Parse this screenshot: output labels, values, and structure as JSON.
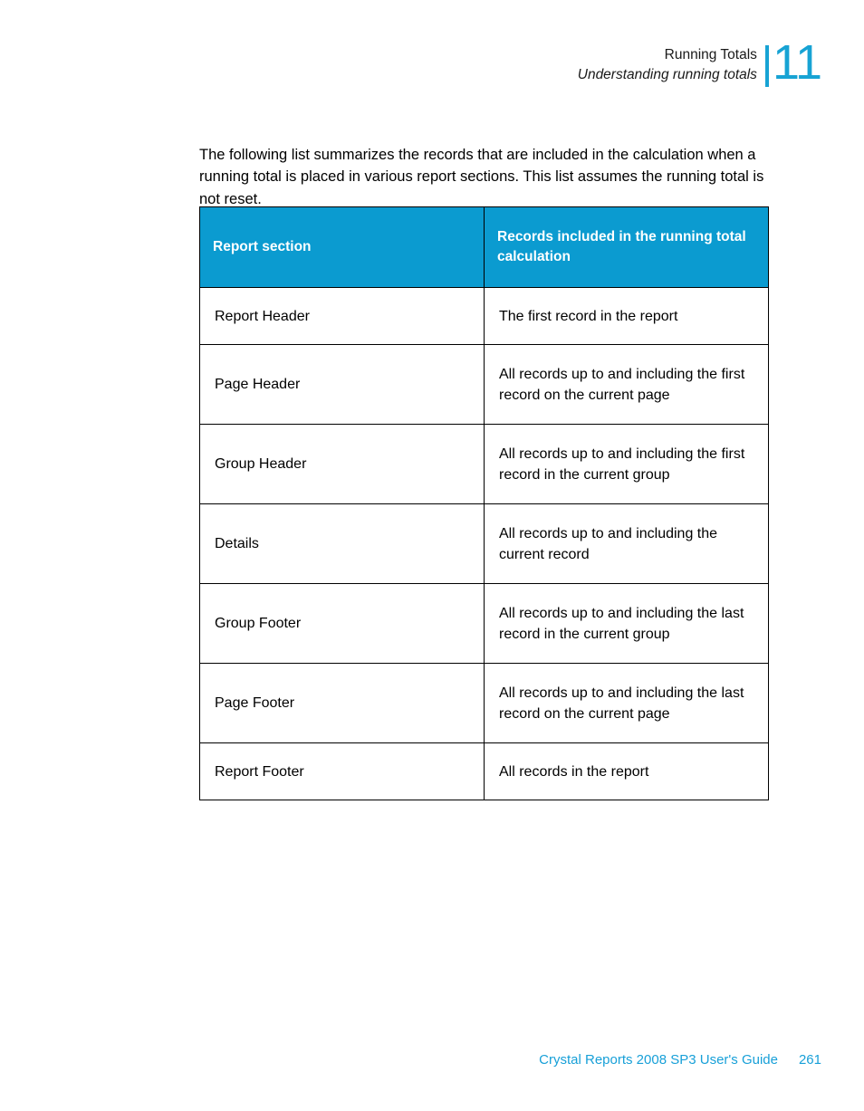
{
  "running_head": {
    "title": "Running Totals",
    "subtitle": "Understanding running totals",
    "chapter_number": "11",
    "accent_color": "#17a3d4"
  },
  "intro_paragraph": "The following list summarizes the records that are included in the calculation when a running total is placed in various report sections. This list assumes the running total is not reset.",
  "table": {
    "header_background": "#0b9bd0",
    "header_text_color": "#ffffff",
    "columns": [
      "Report section",
      "Records included in the running total calculation"
    ],
    "rows": [
      {
        "section": "Report Header",
        "records": "The first record in the report"
      },
      {
        "section": "Page Header",
        "records": "All records up to and including the first record on the current page"
      },
      {
        "section": "Group Header",
        "records": "All records up to and including the first record in the current group"
      },
      {
        "section": "Details",
        "records": "All records up to and including the current record"
      },
      {
        "section": "Group Footer",
        "records": "All records up to and including the last record in the current group"
      },
      {
        "section": "Page Footer",
        "records": "All records up to and including the last record on the current page"
      },
      {
        "section": "Report Footer",
        "records": "All records in the report"
      }
    ]
  },
  "footer": {
    "guide_title": "Crystal Reports 2008 SP3 User's Guide",
    "page_number": "261",
    "color": "#18a0d8"
  }
}
